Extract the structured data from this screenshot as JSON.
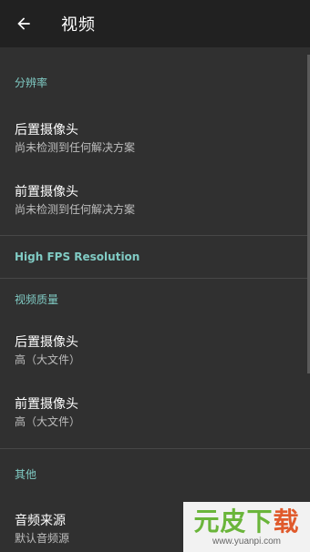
{
  "toolbar": {
    "title": "视频",
    "back_icon": "arrow-left-icon"
  },
  "sections": {
    "resolution": {
      "header": "分辨率",
      "items": [
        {
          "title": "后置摄像头",
          "subtitle": "尚未检测到任何解决方案"
        },
        {
          "title": "前置摄像头",
          "subtitle": "尚未检测到任何解决方案"
        }
      ]
    },
    "high_fps": {
      "header": "High FPS Resolution"
    },
    "quality": {
      "header": "视频质量",
      "items": [
        {
          "title": "后置摄像头",
          "subtitle": "高（大文件）"
        },
        {
          "title": "前置摄像头",
          "subtitle": "高（大文件）"
        }
      ]
    },
    "other": {
      "header": "其他",
      "items": [
        {
          "title": "音频来源",
          "subtitle": "默认音频源"
        }
      ]
    }
  },
  "watermark": {
    "logo_main": "元皮下",
    "logo_accent": "载",
    "url": "www.yuanpi.com"
  },
  "colors": {
    "background": "#303030",
    "toolbar": "#212121",
    "accent": "#80cbc4",
    "divider": "#474747"
  }
}
